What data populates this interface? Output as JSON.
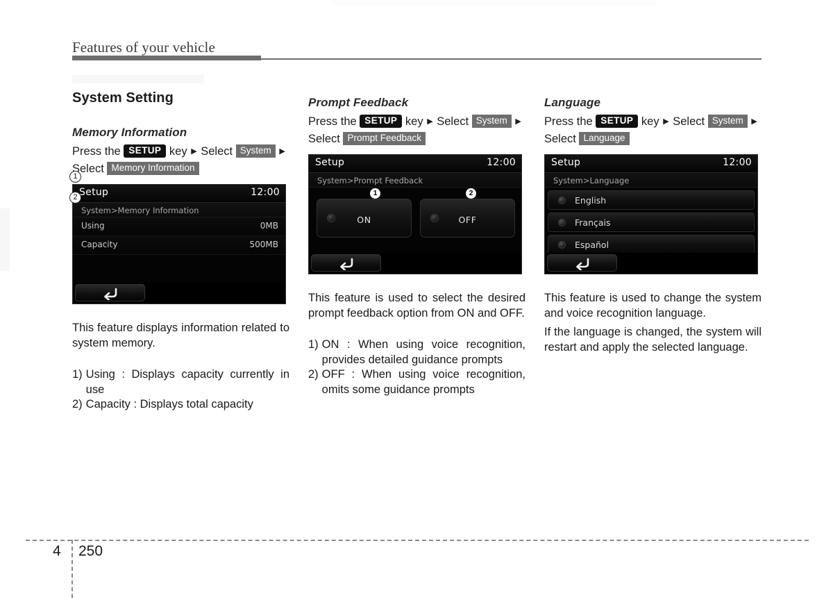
{
  "header": {
    "running_title": "Features of your vehicle"
  },
  "footer": {
    "chapter": "4",
    "page": "250"
  },
  "columns": {
    "col1": {
      "section_title": "System Setting",
      "sub_title": "Memory Information",
      "path": {
        "press_the": "Press the",
        "key_label": "SETUP",
        "key_word": "key",
        "select_1": "Select",
        "chip_1": "System",
        "select_2": "Select",
        "chip_2": "Memory Information",
        "arrow": "▶"
      },
      "screen": {
        "title": "Setup",
        "clock": "12:00",
        "breadcrumb": "System>Memory Information",
        "rows": [
          {
            "label": "Using",
            "value": "0MB",
            "callout": "1"
          },
          {
            "label": "Capacity",
            "value": "500MB",
            "callout": "2"
          }
        ],
        "back_label": "back"
      },
      "paragraph": "This feature displays information related to system memory.",
      "list": [
        {
          "num": "1)",
          "text": "Using : Displays capacity currently in use"
        },
        {
          "num": "2)",
          "text": "Capacity : Displays total capacity"
        }
      ]
    },
    "col2": {
      "sub_title": "Prompt Feedback",
      "path": {
        "press_the": "Press the",
        "key_label": "SETUP",
        "key_word": "key",
        "select_1": "Select",
        "chip_1": "System",
        "select_2": "Select",
        "chip_2": "Prompt Feedback",
        "arrow": "▶"
      },
      "screen": {
        "title": "Setup",
        "clock": "12:00",
        "breadcrumb": "System>Prompt Feedback",
        "options": [
          {
            "label": "ON",
            "callout": "1"
          },
          {
            "label": "OFF",
            "callout": "2"
          }
        ],
        "back_label": "back"
      },
      "paragraph": "This feature is used to select the desired prompt feedback option from ON and OFF.",
      "list": [
        {
          "num": "1)",
          "text": "ON : When using voice recognition, provides detailed guidance prompts"
        },
        {
          "num": "2)",
          "text": "OFF : When using voice recognition, omits some guidance prompts"
        }
      ]
    },
    "col3": {
      "sub_title": "Language",
      "path": {
        "press_the": "Press the",
        "key_label": "SETUP",
        "key_word": "key",
        "select_1": "Select",
        "chip_1": "System",
        "select_2": "Select",
        "chip_2": "Language",
        "arrow": "▶"
      },
      "screen": {
        "title": "Setup",
        "clock": "12:00",
        "breadcrumb": "System>Language",
        "languages": [
          {
            "label": "English"
          },
          {
            "label": "Français"
          },
          {
            "label": "Español"
          }
        ],
        "back_label": "back"
      },
      "paragraph_1": "This feature is used to change the system and voice recognition language.",
      "paragraph_2": "If the language is changed, the system will restart and apply the selected language."
    }
  }
}
